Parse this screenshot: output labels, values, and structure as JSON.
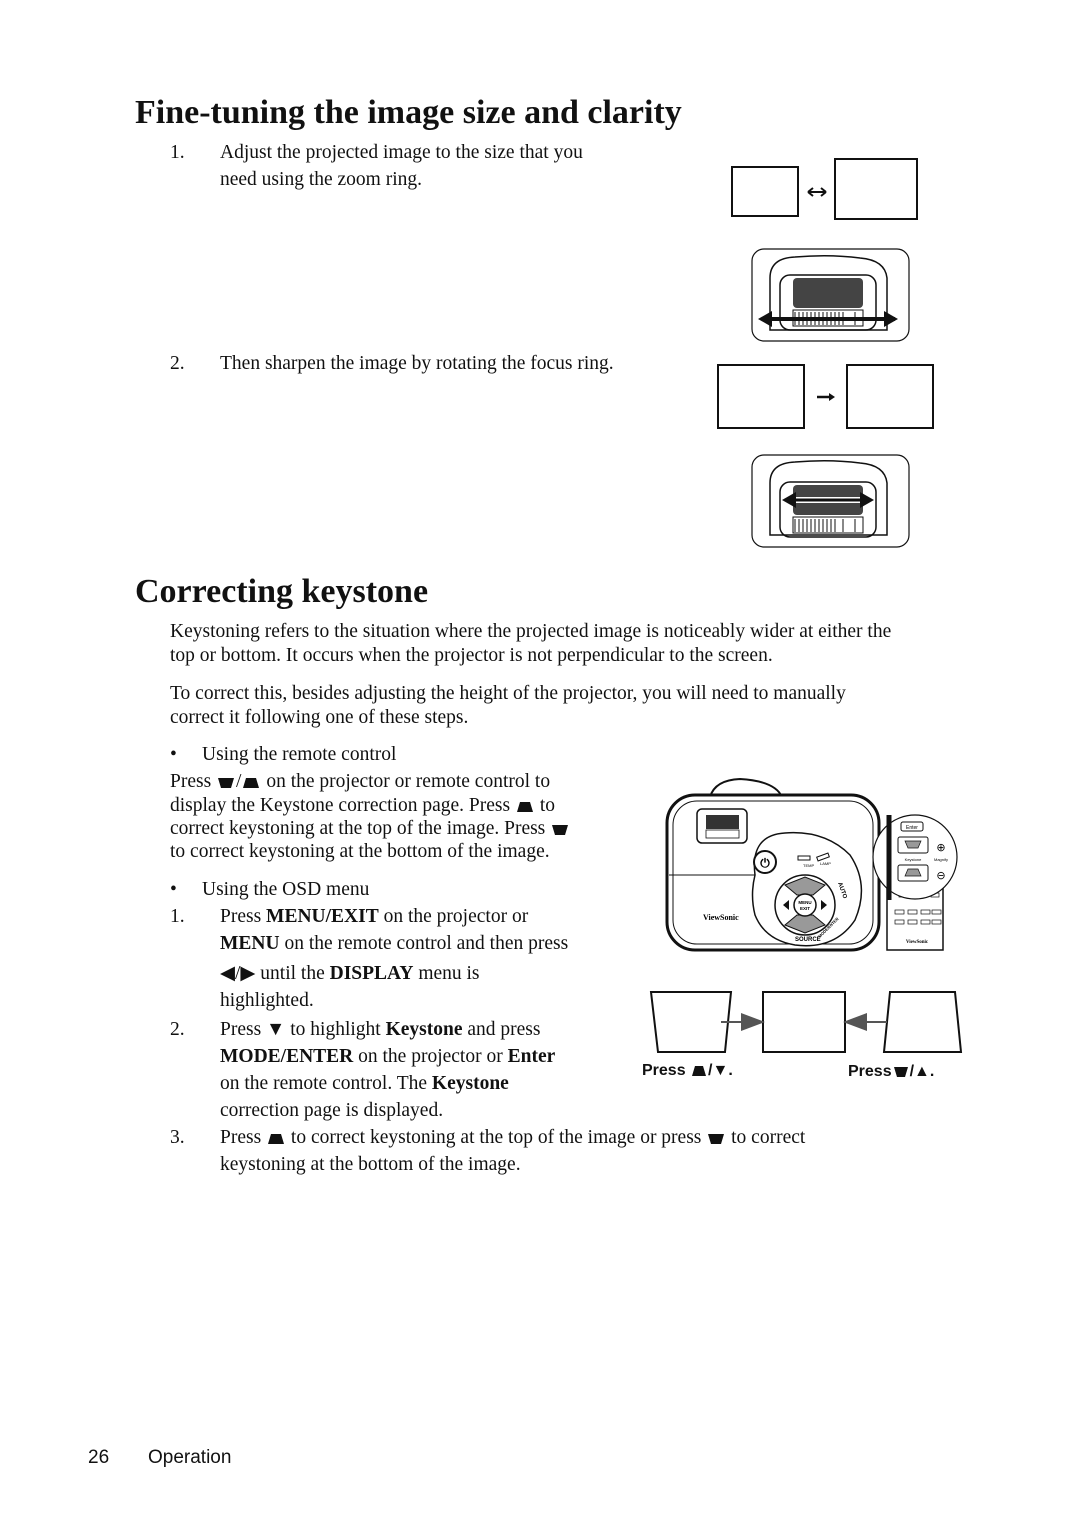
{
  "section1": {
    "title": "Fine-tuning the image size and clarity",
    "steps": [
      {
        "num": "1.",
        "lines": [
          "Adjust the projected image to the size that you",
          "need using the zoom ring."
        ]
      },
      {
        "num": "2.",
        "lines": [
          "Then sharpen the image by rotating the focus ring."
        ]
      }
    ]
  },
  "section2": {
    "title": "Correcting keystone",
    "para1": [
      "Keystoning refers to the situation where the projected image is noticeably wider at either the",
      "top or bottom. It occurs when the projector is not perpendicular to the screen."
    ],
    "para2": [
      "To correct this, besides adjusting the height of the projector, you will need to manually",
      "correct it following one of these steps."
    ],
    "bullet_remote": "Using the remote control",
    "remote": {
      "l1a": "Press",
      "l1b": "/",
      "l1c": "on the projector or remote control to",
      "l2a": "display the Keystone correction page. Press",
      "l2b": "to",
      "l3a": "correct keystoning at the top of the image. Press",
      "l4": "to correct keystoning at the bottom of the image."
    },
    "bullet_osd": "Using the OSD menu",
    "osd": {
      "s1num": "1.",
      "s1a": "Press",
      "s1b": "MENU/EXIT",
      "s1c": "on the projector or",
      "s1d": "MENU",
      "s1e": "on the remote control and then press",
      "s1f": "◀/▶",
      "s1g": "until the",
      "s1h": "DISPLAY",
      "s1i": "menu is",
      "s1j": "highlighted.",
      "s2num": "2.",
      "s2a": "Press",
      "s2b": "▼",
      "s2c": "to highlight",
      "s2d": "Keystone",
      "s2e": "and press",
      "s2f": "MODE/ENTER",
      "s2g": "on the projector or",
      "s2h": "Enter",
      "s2i": "on the remote control. The",
      "s2j": "Keystone",
      "s2k": "correction page is displayed.",
      "s3num": "3.",
      "s3a": "Press",
      "s3b": "to correct keystoning at the top of the image or press",
      "s3c": "to correct",
      "s3d": "keystoning at the bottom of the image."
    },
    "figure": {
      "brand": "ViewSonic",
      "menu_label": "MENU",
      "exit_label": "EXIT",
      "source_label": "SOURCE",
      "auto_label": "AUTO",
      "mode_label": "MODE/ENTER",
      "temp_label": "TEMP",
      "lamp_label": "LAMP",
      "enter_label": "Enter",
      "keystone_label": "Keystone",
      "magnify_label": "Magnify",
      "press_left": "Press",
      "press_left_sep": "/▼.",
      "press_right": "Press",
      "press_right_sep": "/▲."
    }
  },
  "footer": {
    "page": "26",
    "section": "Operation"
  }
}
